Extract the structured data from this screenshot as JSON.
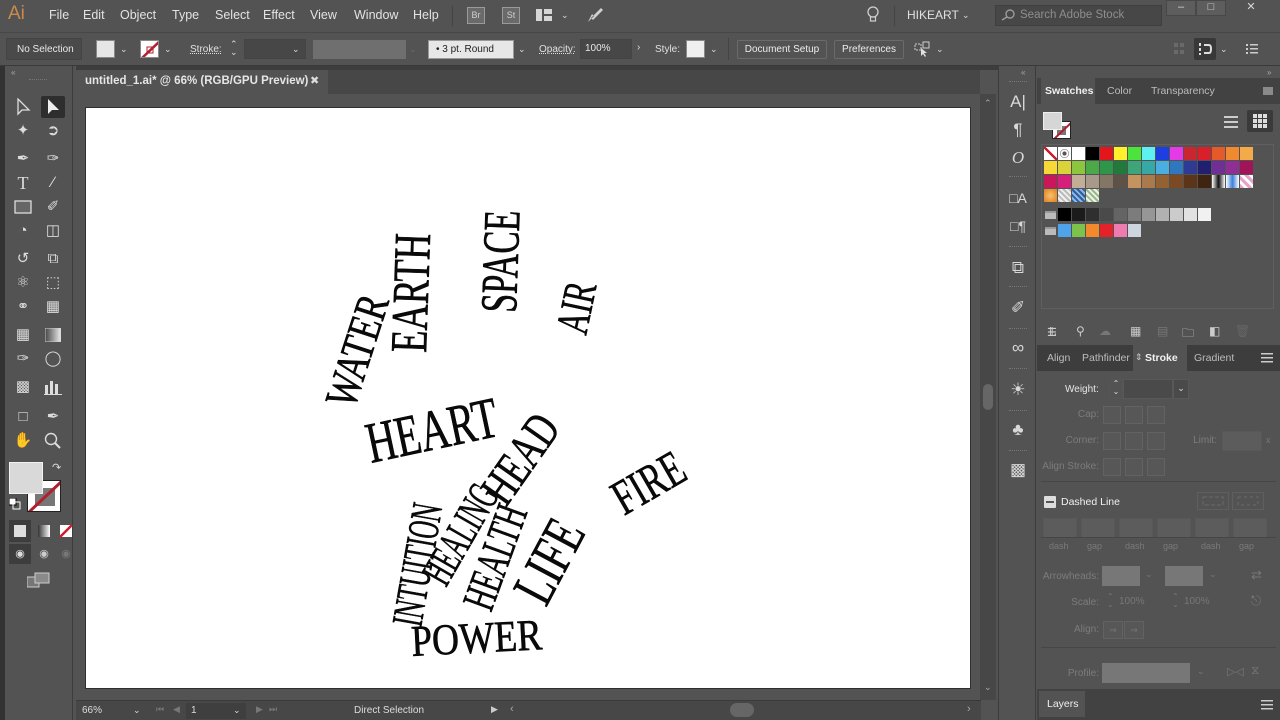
{
  "app": {
    "logo": "Ai",
    "menu": [
      "File",
      "Edit",
      "Object",
      "Type",
      "Select",
      "Effect",
      "View",
      "Window",
      "Help"
    ],
    "bridge_label": "Br",
    "stock_label": "St",
    "workspace": "HIKEART",
    "search_placeholder": "Search Adobe Stock",
    "window_controls": {
      "minimize": "–",
      "maximize": "□",
      "close": "✕"
    }
  },
  "control_bar": {
    "selection": "No Selection",
    "stroke_label": "Stroke:",
    "brush": "•  3 pt. Round",
    "opacity_label": "Opacity:",
    "opacity_value": "100%",
    "style_label": "Style:",
    "document_setup": "Document Setup",
    "preferences": "Preferences"
  },
  "document": {
    "tab_title": "untitled_1.ai* @ 66% (RGB/GPU Preview)",
    "close": "✖",
    "artwork_words": [
      "WATER",
      "EARTH",
      "SPACE",
      "AIR",
      "HEART",
      "HEAD",
      "FIRE",
      "LIFE",
      "HEALTH",
      "HEALING",
      "INTUITION",
      "POWER"
    ]
  },
  "status_bar": {
    "zoom": "66%",
    "artboard_number": "1",
    "current_tool": "Direct Selection"
  },
  "toolbar": {
    "tools": [
      "selection",
      "direct-selection",
      "magic-wand",
      "lasso",
      "pen",
      "curvature",
      "type",
      "line-segment",
      "rectangle",
      "paintbrush",
      "shaper",
      "eraser",
      "rotate",
      "scale",
      "puppet-warp",
      "free-transform",
      "shape-builder",
      "perspective-grid",
      "mesh",
      "gradient",
      "eyedropper",
      "blend",
      "symbol-sprayer",
      "column-graph",
      "artboard",
      "slice",
      "hand",
      "zoom"
    ]
  },
  "swatches_panel": {
    "tabs": [
      "Swatches",
      "Color",
      "Transparency"
    ],
    "active_tab": "Swatches",
    "row1": [
      "none",
      "registration",
      "#ffffff",
      "#000000",
      "#e3161b",
      "#fff22d",
      "#4ce33c",
      "#5ff0f2",
      "#1d3ee0",
      "#e53be6",
      "#c9262f",
      "#d81f2a",
      "#e45a29",
      "#ef8a30",
      "#f3aa48"
    ],
    "row2": [
      "#f6d837",
      "#d8d43a",
      "#8cc63f",
      "#4ca948",
      "#2e9648",
      "#217a3c",
      "#3da57a",
      "#38a8a6",
      "#4aaee0",
      "#2f78c0",
      "#2e3a94",
      "#231f70",
      "#6f2f94",
      "#8f2f94",
      "#a1145a"
    ],
    "row3": [
      "#c8175b",
      "#d61f7b",
      "#c4ad96",
      "#a8998b",
      "#847565",
      "#5e5147",
      "#c4935e",
      "#ab7a4c",
      "#946133",
      "#7b4a24",
      "#5b3519",
      "#3f2412",
      "gradient-bw",
      "gradient-blue",
      "pattern-pink"
    ],
    "row4": [
      "gradient-orange",
      "pattern-dots",
      "pattern-blue",
      "pattern-green"
    ],
    "gray_group": [
      "#000000",
      "#1b1b1b",
      "#2f2f2f",
      "#4a4a4a",
      "#646464",
      "#7c7c7c",
      "#969696",
      "#b1b1b1",
      "#cbcbcb",
      "#e1e1e1",
      "#f1f1f1"
    ],
    "color_group": [
      "#4fa3e8",
      "#7dc24a",
      "#f28a2b",
      "#e3222a",
      "#ee7cb0",
      "#cdd6df"
    ]
  },
  "stroke_panel": {
    "tabs": [
      "Align",
      "Pathfinder",
      "Stroke",
      "Gradient"
    ],
    "active_tab": "Stroke",
    "weight_label": "Weight:",
    "cap_label": "Cap:",
    "corner_label": "Corner:",
    "limit_label": "Limit:",
    "align_stroke_label": "Align Stroke:",
    "dashed_line_label": "Dashed Line",
    "dash_fields": [
      "dash",
      "gap",
      "dash",
      "gap",
      "dash",
      "gap"
    ],
    "arrowheads_label": "Arrowheads:",
    "scale_label": "Scale:",
    "scale_start": "100%",
    "scale_end": "100%",
    "align_label": "Align:",
    "profile_label": "Profile:"
  },
  "layers_panel": {
    "title": "Layers"
  }
}
